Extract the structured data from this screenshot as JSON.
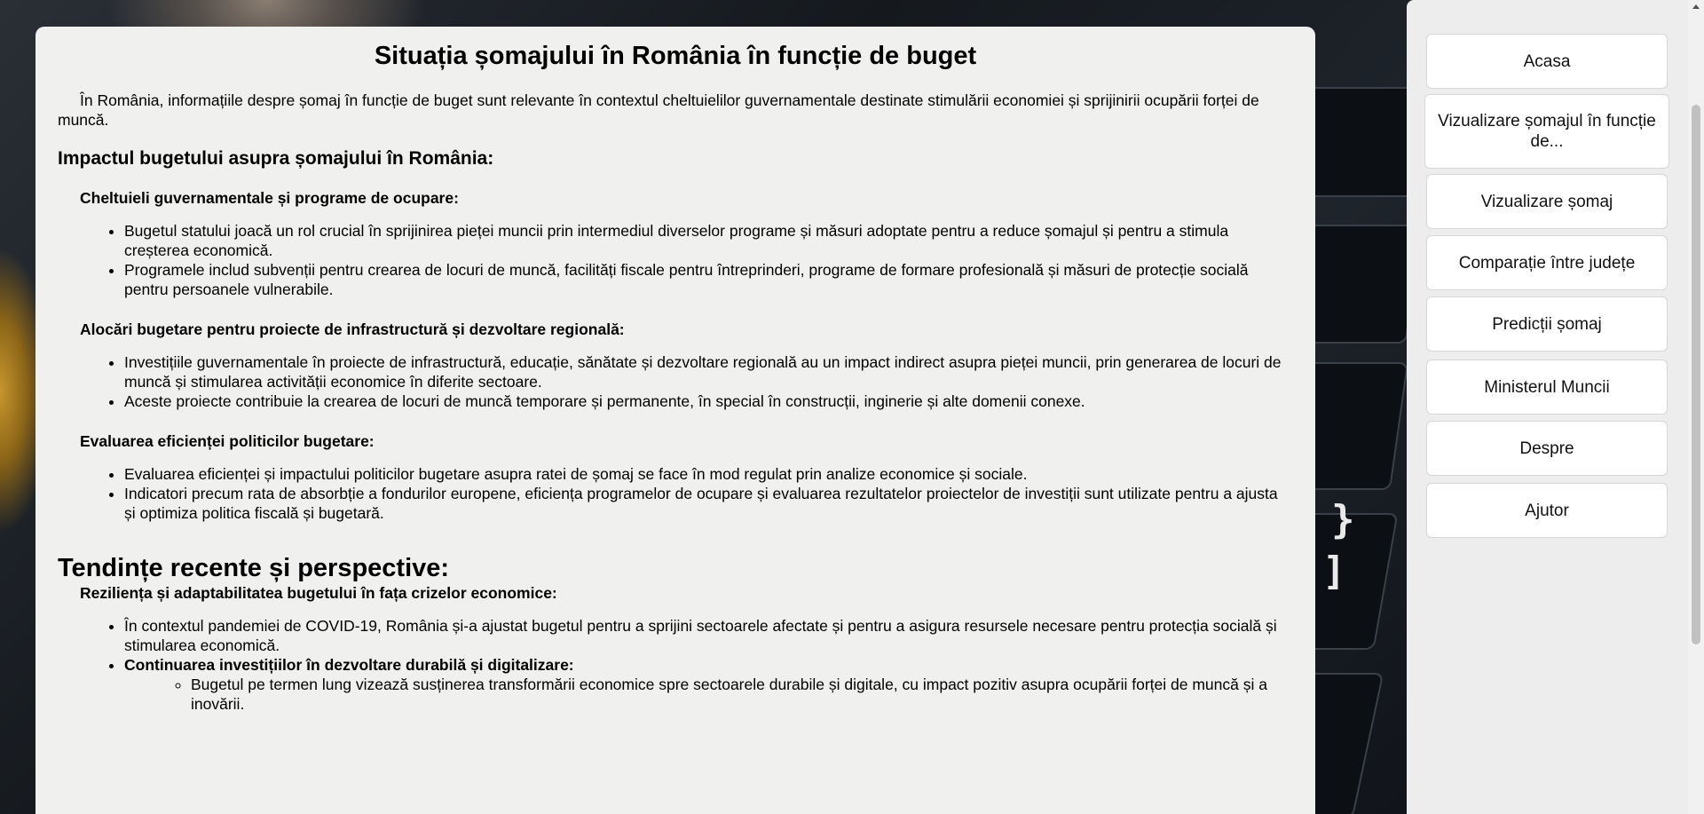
{
  "article": {
    "title": "Situația șomajului în România în funcție de buget",
    "intro": "În România, informațiile despre șomaj în funcție de buget sunt relevante în contextul cheltuielilor guvernamentale destinate stimulării economiei și sprijinirii ocupării forței de muncă.",
    "section1_heading": "Impactul bugetului asupra șomajului în România:",
    "sub1_heading": "Cheltuieli guvernamentale și programe de ocupare:",
    "sub1_items": [
      "Bugetul statului joacă un rol crucial în sprijinirea pieței muncii prin intermediul diverselor programe și măsuri adoptate pentru a reduce șomajul și pentru a stimula creșterea economică.",
      "Programele includ subvenții pentru crearea de locuri de muncă, facilități fiscale pentru întreprinderi, programe de formare profesională și măsuri de protecție socială pentru persoanele vulnerabile."
    ],
    "sub2_heading": "Alocări bugetare pentru proiecte de infrastructură și dezvoltare regională:",
    "sub2_items": [
      "Investițiile guvernamentale în proiecte de infrastructură, educație, sănătate și dezvoltare regională au un impact indirect asupra pieței muncii, prin generarea de locuri de muncă și stimularea activității economice în diferite sectoare.",
      "Aceste proiecte contribuie la crearea de locuri de muncă temporare și permanente, în special în construcții, inginerie și alte domenii conexe."
    ],
    "sub3_heading": "Evaluarea eficienței politicilor bugetare:",
    "sub3_items": [
      "Evaluarea eficienței și impactului politicilor bugetare asupra ratei de șomaj se face în mod regulat prin analize economice și sociale.",
      "Indicatori precum rata de absorbție a fondurilor europene, eficiența programelor de ocupare și evaluarea rezultatelor proiectelor de investiții sunt utilizate pentru a ajusta și optimiza politica fiscală și bugetară."
    ],
    "section2_heading": "Tendințe recente și perspective:",
    "sub4_heading": "Reziliența și adaptabilitatea bugetului în fața crizelor economice:",
    "sub4_items": [
      "În contextul pandemiei de COVID-19, România și-a ajustat bugetul pentru a sprijini sectoarele afectate și pentru a asigura resursele necesare pentru protecția socială și stimularea economică."
    ],
    "sub4_bold_item": "Continuarea investițiilor în dezvoltare durabilă și digitalizare:",
    "sub4_nested_items": [
      "Bugetul pe termen lung vizează susținerea transformării economice spre sectoarele durabile și digitale, cu impact pozitiv asupra ocupării forței de muncă și a inovării."
    ]
  },
  "nav": {
    "items": [
      "Acasa",
      "Vizualizare șomajul în funcție de...",
      "Vizualizare șomaj",
      "Comparație între județe",
      "Predicții șomaj",
      "Ministerul Muncii",
      "Despre",
      "Ajutor"
    ]
  },
  "background": {
    "glyphs": [
      "}",
      "]"
    ]
  }
}
